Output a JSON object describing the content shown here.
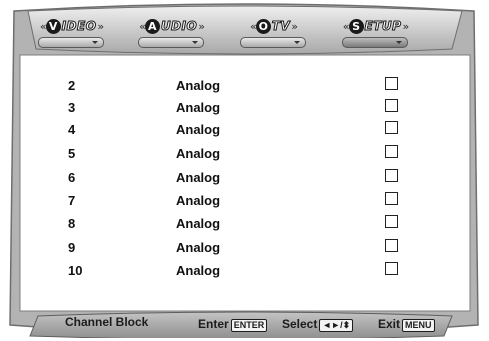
{
  "tabs": [
    {
      "letter": "V",
      "word": "IDEO",
      "active": false
    },
    {
      "letter": "A",
      "word": "UDIO",
      "active": false
    },
    {
      "letter": "O",
      "word": "TV",
      "active": false
    },
    {
      "letter": "S",
      "word": "ETUP",
      "active": true
    }
  ],
  "channels": [
    {
      "number": "2",
      "type": "Analog",
      "blocked": false
    },
    {
      "number": "3",
      "type": "Analog",
      "blocked": false
    },
    {
      "number": "4",
      "type": "Analog",
      "blocked": false
    },
    {
      "number": "5",
      "type": "Analog",
      "blocked": false
    },
    {
      "number": "6",
      "type": "Analog",
      "blocked": false
    },
    {
      "number": "7",
      "type": "Analog",
      "blocked": false
    },
    {
      "number": "8",
      "type": "Analog",
      "blocked": false
    },
    {
      "number": "9",
      "type": "Analog",
      "blocked": false
    },
    {
      "number": "10",
      "type": "Analog",
      "blocked": false
    }
  ],
  "bottom": {
    "title": "Channel Block",
    "enter_label": "Enter",
    "enter_key": "ENTER",
    "select_label": "Select",
    "select_key": "◄►/⬍",
    "exit_label": "Exit",
    "exit_key": "MENU"
  },
  "icons": {
    "dropdown": "triangle-down-icon"
  },
  "colors": {
    "frame_light": "#d9d9d9",
    "frame_dark": "#8c8c8c",
    "text": "#111111"
  }
}
